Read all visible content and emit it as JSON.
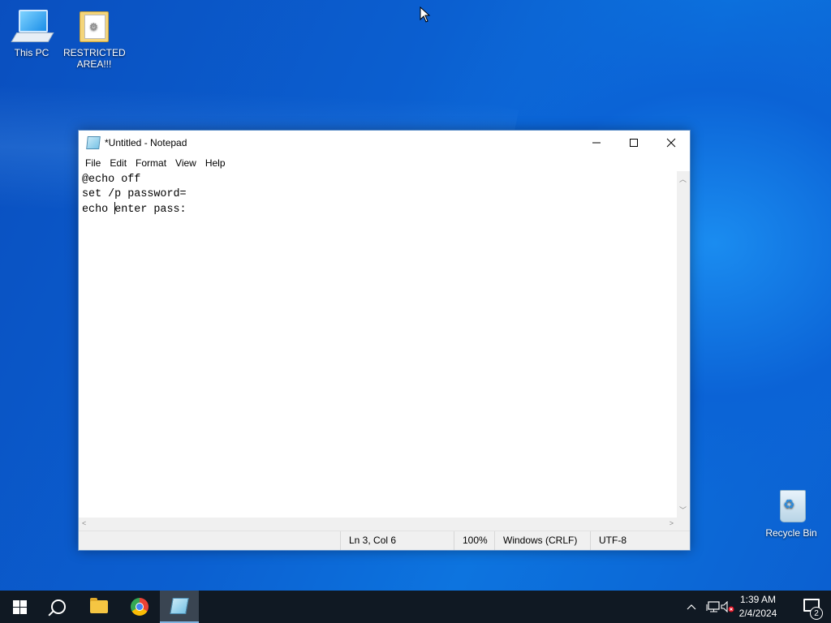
{
  "desktop": {
    "icons": [
      {
        "label": "This PC"
      },
      {
        "label": "RESTRICTED AREA!!!"
      },
      {
        "label": "Recycle Bin"
      }
    ]
  },
  "notepad": {
    "title": "*Untitled - Notepad",
    "menu": [
      "File",
      "Edit",
      "Format",
      "View",
      "Help"
    ],
    "lines": [
      "@echo off",
      "set /p password=",
      "echo enter pass:"
    ],
    "line3_before_caret": "echo ",
    "line3_after_caret": "enter pass:",
    "status": {
      "position": "Ln 3, Col 6",
      "zoom": "100%",
      "line_ending": "Windows (CRLF)",
      "encoding": "UTF-8"
    }
  },
  "taskbar": {
    "time": "1:39 AM",
    "date": "2/4/2024",
    "notifications": "2"
  }
}
